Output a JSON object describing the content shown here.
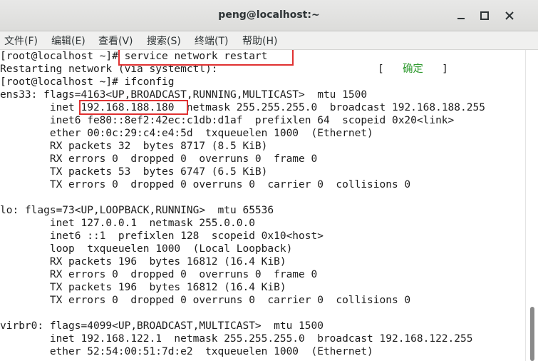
{
  "window": {
    "title": "peng@localhost:~"
  },
  "menu": [
    "文件(F)",
    "编辑(E)",
    "查看(V)",
    "搜索(S)",
    "终端(T)",
    "帮助(H)"
  ],
  "terminal": {
    "prompt1": "[root@localhost ~]# ",
    "cmd1": "service network restart",
    "restarting": "Restarting network (via systemctl):",
    "ok_open": "[",
    "ok_text": "确定",
    "ok_close": "]",
    "prompt2": "[root@localhost ~]# ifconfig",
    "ens33_flags": "ens33: flags=4163<UP,BROADCAST,RUNNING,MULTICAST>  mtu 1500",
    "ens33_inet_label": "        inet ",
    "ens33_inet_ip": "192.168.188.180",
    "ens33_inet_rest": "  netmask 255.255.255.0  broadcast 192.168.188.255",
    "ens33_inet6": "        inet6 fe80::8ef2:42ec:c1db:d1af  prefixlen 64  scopeid 0x20<link>",
    "ens33_ether": "        ether 00:0c:29:c4:e4:5d  txqueuelen 1000  (Ethernet)",
    "ens33_rx_packets": "        RX packets 32  bytes 8717 (8.5 KiB)",
    "ens33_rx_errors": "        RX errors 0  dropped 0  overruns 0  frame 0",
    "ens33_tx_packets": "        TX packets 53  bytes 6747 (6.5 KiB)",
    "ens33_tx_errors": "        TX errors 0  dropped 0 overruns 0  carrier 0  collisions 0",
    "lo_flags": "lo: flags=73<UP,LOOPBACK,RUNNING>  mtu 65536",
    "lo_inet": "        inet 127.0.0.1  netmask 255.0.0.0",
    "lo_inet6": "        inet6 ::1  prefixlen 128  scopeid 0x10<host>",
    "lo_loop": "        loop  txqueuelen 1000  (Local Loopback)",
    "lo_rx_packets": "        RX packets 196  bytes 16812 (16.4 KiB)",
    "lo_rx_errors": "        RX errors 0  dropped 0  overruns 0  frame 0",
    "lo_tx_packets": "        TX packets 196  bytes 16812 (16.4 KiB)",
    "lo_tx_errors": "        TX errors 0  dropped 0 overruns 0  carrier 0  collisions 0",
    "virbr0_flags": "virbr0: flags=4099<UP,BROADCAST,MULTICAST>  mtu 1500",
    "virbr0_inet": "        inet 192.168.122.1  netmask 255.255.255.0  broadcast 192.168.122.255",
    "virbr0_ether": "        ether 52:54:00:51:7d:e2  txqueuelen 1000  (Ethernet)"
  },
  "colors": {
    "highlight": "#e03131",
    "ok_green": "#2f9a2f"
  },
  "icons": [
    "minimize-icon",
    "maximize-icon",
    "close-icon"
  ]
}
